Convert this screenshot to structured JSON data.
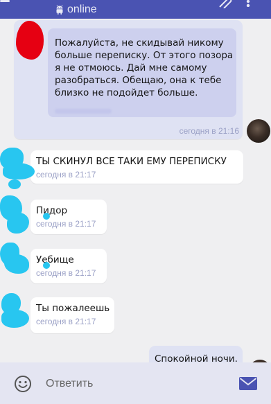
{
  "header": {
    "status": "online",
    "colors": {
      "bar": "#4a53b2",
      "text": "#e8e9f5"
    }
  },
  "messages": [
    {
      "direction": "outgoing",
      "text": "Пожалуйста, не скидывай никому больше переписку. От этого позора я не отмоюсь. Дай мне самому разобраться. Обещаю, она к тебе близко не подойдет больше.",
      "time": "сегодня в 21:16"
    },
    {
      "direction": "incoming",
      "text": "ТЫ СКИНУЛ ВСЕ ТАКИ ЕМУ ПЕРЕПИСКУ",
      "time": "сегодня в 21:17"
    },
    {
      "direction": "incoming",
      "text": "Пидор",
      "time": "сегодня в 21:17"
    },
    {
      "direction": "incoming",
      "text": "Уебище",
      "time": "сегодня в 21:17"
    },
    {
      "direction": "incoming",
      "text": "Ты пожалеешь",
      "time": "сегодня в 21:17"
    },
    {
      "direction": "outgoing",
      "text": "Спокойной ночи.",
      "time": ""
    }
  ],
  "composer": {
    "placeholder": "Ответить"
  },
  "icons": {
    "status": "android-icon",
    "attach": "paperclip-icon",
    "more": "more-vert-icon",
    "emoji": "emoji-icon",
    "send": "send-envelope-icon"
  },
  "colors": {
    "background": "#efeff1",
    "outgoing_bubble": "#dfe2f3",
    "quote_block": "#cdd0ee",
    "timestamp": "#9aa0c6",
    "send": "#4a53b2",
    "redaction_blue": "#28c6f0",
    "redaction_red": "#e60012"
  }
}
